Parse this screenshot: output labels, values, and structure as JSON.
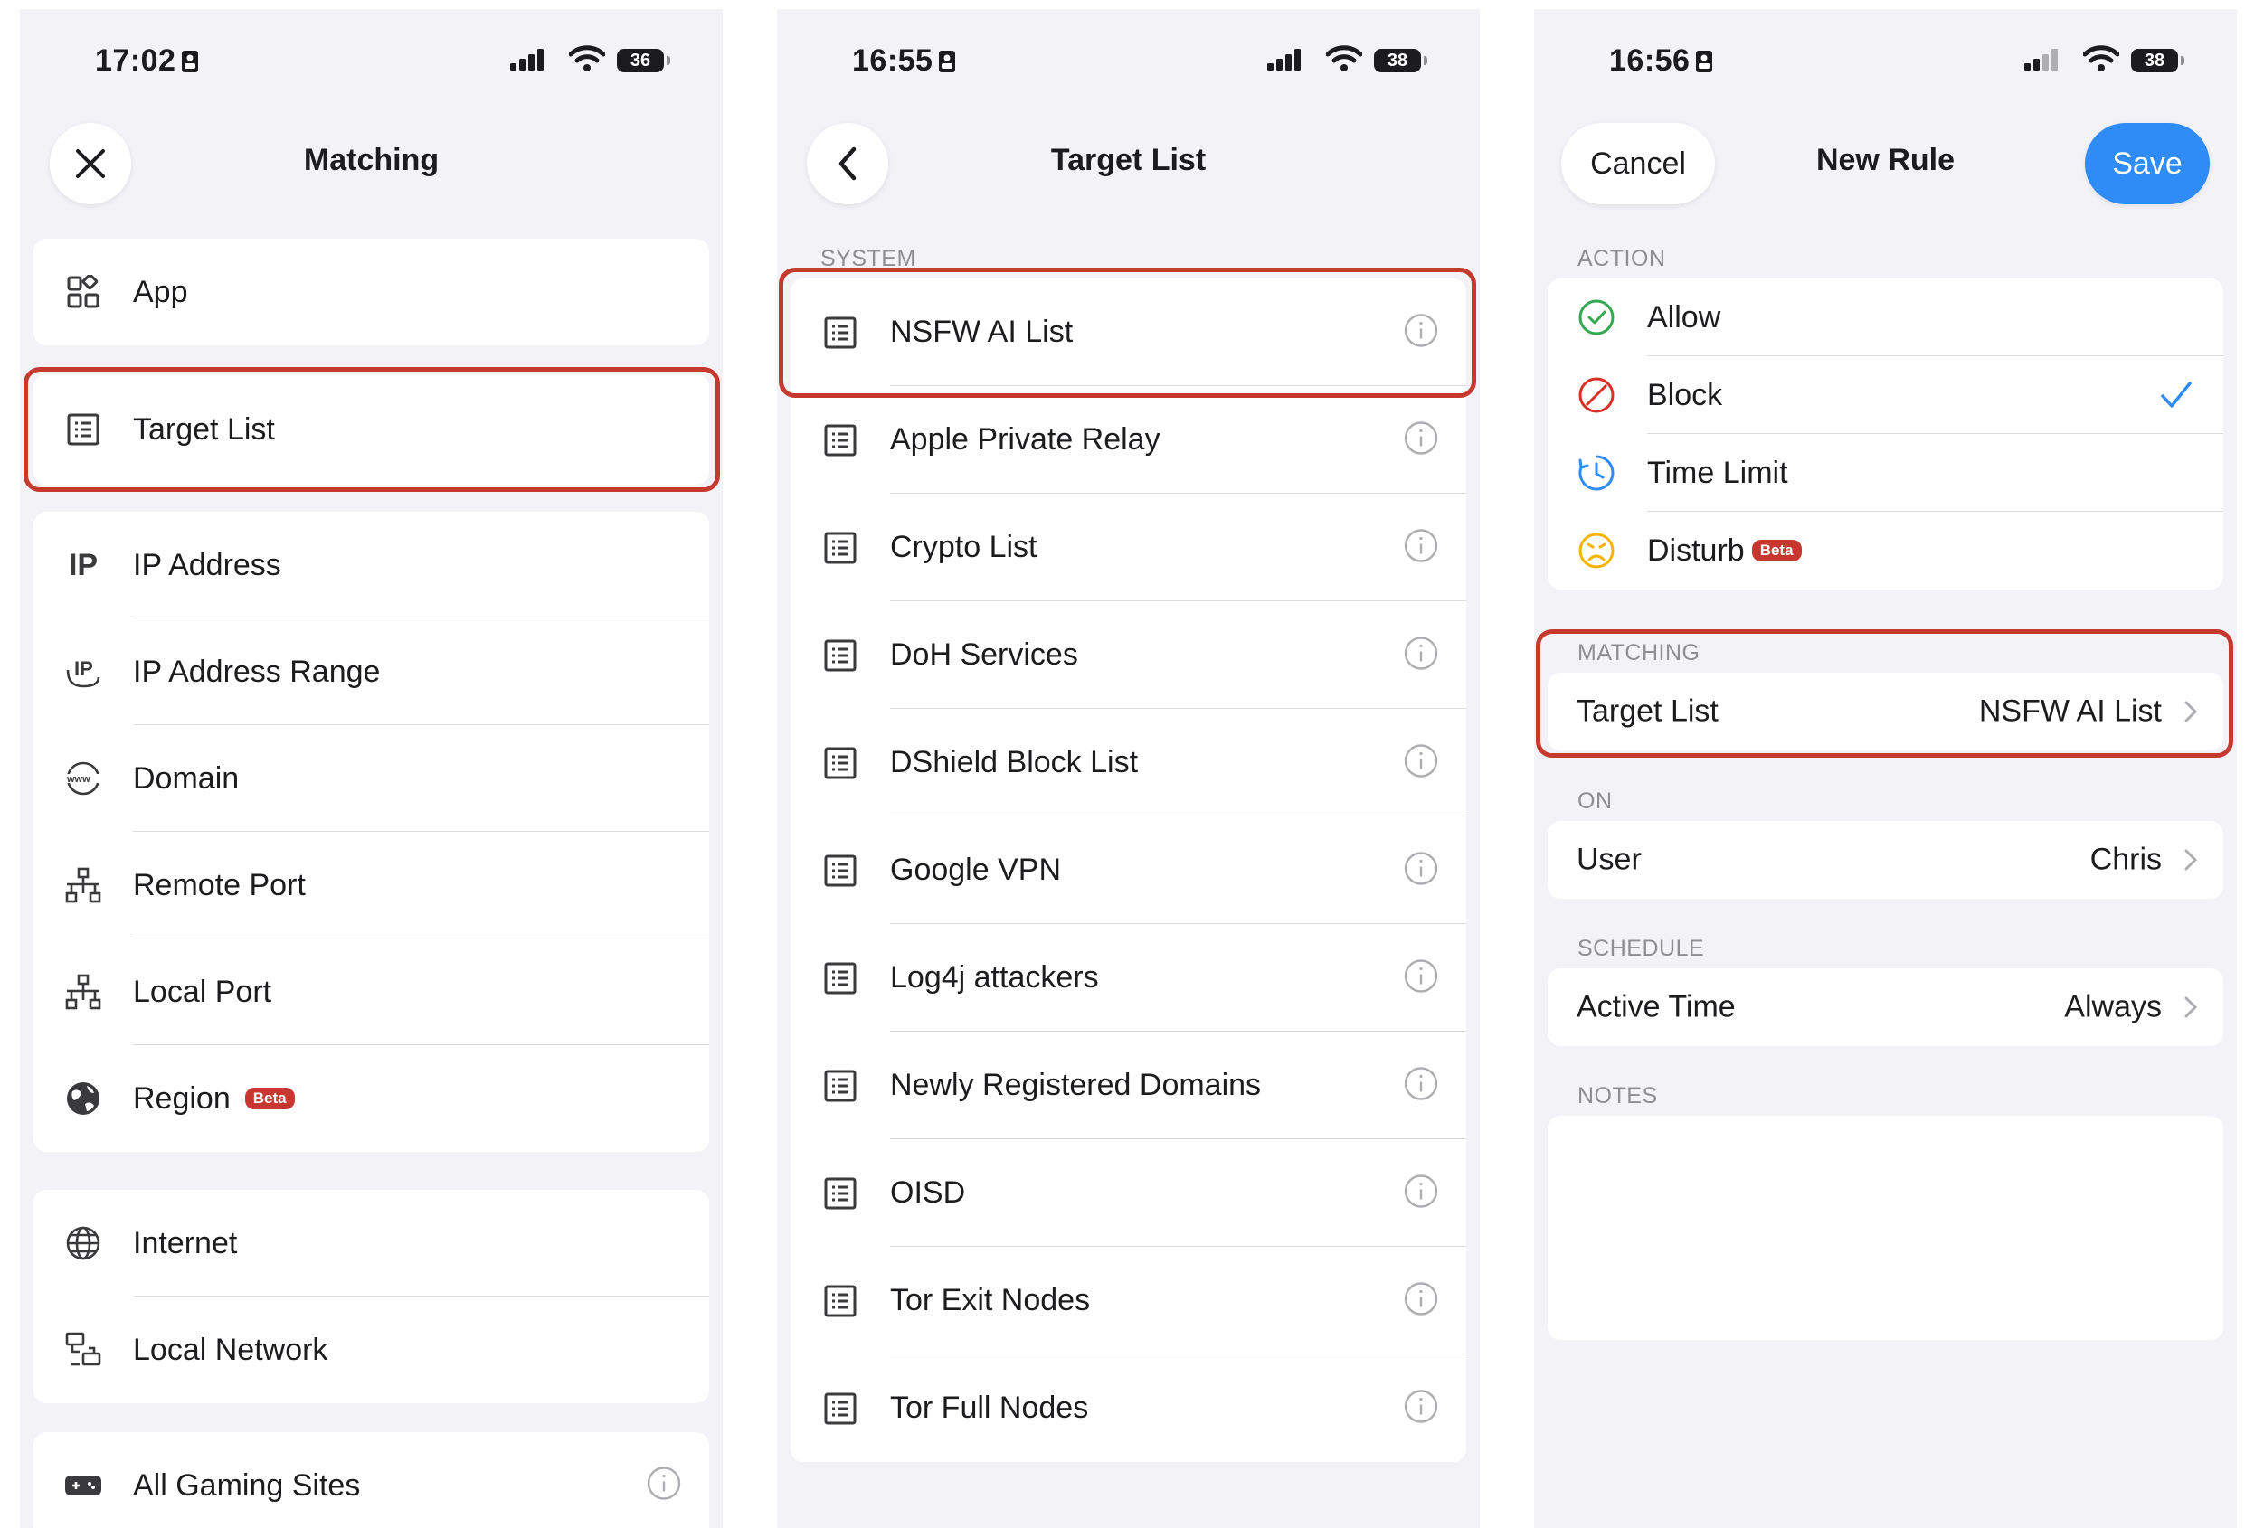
{
  "screen1": {
    "status_time": "17:02",
    "battery": "36",
    "title": "Matching",
    "group1": [
      {
        "label": "App",
        "icon": "app-grid-icon"
      }
    ],
    "target_list": {
      "label": "Target List",
      "icon": "list-icon"
    },
    "group2": [
      {
        "label": "IP Address",
        "icon": "ip-icon"
      },
      {
        "label": "IP Address Range",
        "icon": "ip-range-icon"
      },
      {
        "label": "Domain",
        "icon": "www-icon"
      },
      {
        "label": "Remote Port",
        "icon": "network-icon"
      },
      {
        "label": "Local Port",
        "icon": "network-icon"
      },
      {
        "label": "Region",
        "icon": "globe-filled-icon",
        "badge": "Beta"
      }
    ],
    "group3": [
      {
        "label": "Internet",
        "icon": "globe-icon"
      },
      {
        "label": "Local Network",
        "icon": "local-network-icon"
      }
    ],
    "group4": [
      {
        "label": "All Gaming Sites",
        "icon": "gamepad-icon"
      }
    ]
  },
  "screen2": {
    "status_time": "16:55",
    "battery": "38",
    "title": "Target List",
    "section": "SYSTEM",
    "items": [
      {
        "label": "NSFW AI List"
      },
      {
        "label": "Apple Private Relay"
      },
      {
        "label": "Crypto List"
      },
      {
        "label": "DoH Services"
      },
      {
        "label": "DShield Block List"
      },
      {
        "label": "Google VPN"
      },
      {
        "label": "Log4j attackers"
      },
      {
        "label": "Newly Registered Domains"
      },
      {
        "label": "OISD"
      },
      {
        "label": "Tor Exit Nodes"
      },
      {
        "label": "Tor Full Nodes"
      }
    ]
  },
  "screen3": {
    "status_time": "16:56",
    "battery": "38",
    "cancel": "Cancel",
    "title": "New Rule",
    "save": "Save",
    "action_header": "ACTION",
    "actions": [
      {
        "label": "Allow",
        "icon": "check-circle-icon",
        "color": "#34a853"
      },
      {
        "label": "Block",
        "icon": "block-icon",
        "color": "#d93025",
        "selected": true
      },
      {
        "label": "Time Limit",
        "icon": "clock-icon",
        "color": "#2f8bf5"
      },
      {
        "label": "Disturb",
        "icon": "frown-icon",
        "color": "#f4b400",
        "badge": "Beta"
      }
    ],
    "matching_header": "MATCHING",
    "matching": {
      "key": "Target List",
      "value": "NSFW AI List"
    },
    "on_header": "ON",
    "on": {
      "key": "User",
      "value": "Chris"
    },
    "schedule_header": "SCHEDULE",
    "schedule": {
      "key": "Active Time",
      "value": "Always"
    },
    "notes_header": "NOTES"
  },
  "colors": {
    "accent": "#2f8bf5",
    "highlight": "#c5392f",
    "beta": "#c7372f"
  }
}
